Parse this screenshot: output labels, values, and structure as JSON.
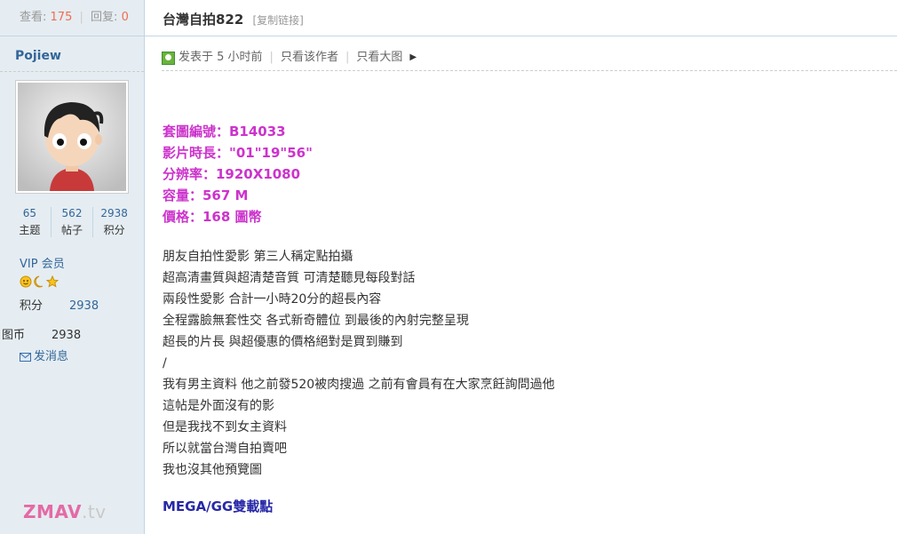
{
  "stats": {
    "views_label": "查看:",
    "views": "175",
    "replies_label": "回复:",
    "replies": "0"
  },
  "author": {
    "name": "Pojiew",
    "counts": [
      {
        "value": "65",
        "label": "主题"
      },
      {
        "value": "562",
        "label": "帖子"
      },
      {
        "value": "2938",
        "label": "积分"
      }
    ],
    "group": "VIP 会员",
    "points_label": "积分",
    "points": "2938",
    "coins_label": "图币",
    "coins": "2938",
    "message_label": "发消息"
  },
  "watermark": {
    "brand": "ZMAV",
    "suffix": ".tv"
  },
  "thread": {
    "title": "台灣自拍822",
    "copy_link": "[复制链接]"
  },
  "meta": {
    "posted": "发表于 5 小时前",
    "only_author": "只看该作者",
    "big_image": "只看大图"
  },
  "specs": [
    "套圖編號：B14033",
    "影片時長：\"01\"19\"56\"",
    "分辨率：1920X1080",
    "容量：567 M",
    "價格：168 圖幣"
  ],
  "body_lines": [
    "朋友自拍性愛影 第三人稱定點拍攝",
    "超高清畫質與超清楚音質 可清楚聽見每段對話",
    "兩段性愛影 合計一小時20分的超長內容",
    "全程露臉無套性交 各式新奇體位 到最後的內射完整呈現",
    "超長的片長 與超優惠的價格絕對是買到賺到",
    "/",
    "我有男主資料 他之前發520被肉搜過 之前有會員有在大家烹飪詢問過他",
    "這帖是外面沒有的影",
    "但是我找不到女主資料",
    "所以就當台灣自拍賣吧",
    "我也沒其他預覽圖"
  ],
  "download_note": "MEGA/GG雙載點"
}
